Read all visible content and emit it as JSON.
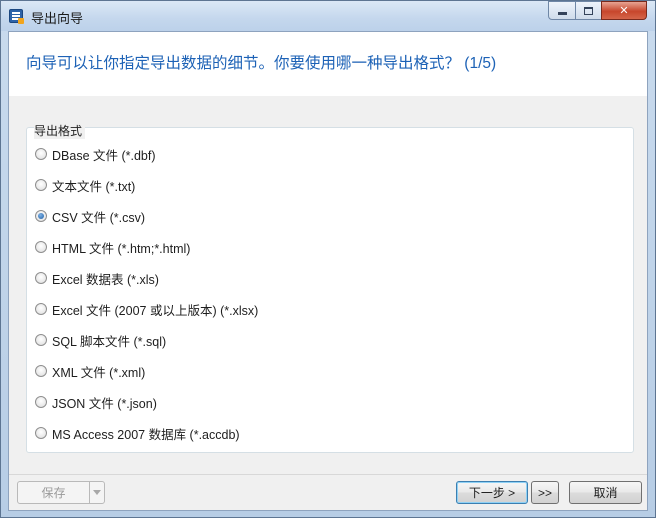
{
  "window": {
    "title": "导出向导",
    "controls": {
      "minimize": "minimize",
      "maximize": "maximize",
      "close": "✕"
    }
  },
  "header": {
    "text": "向导可以让你指定导出数据的细节。你要使用哪一种导出格式？ (1/5)"
  },
  "format_group": {
    "title": "导出格式",
    "options": [
      {
        "label": "DBase 文件 (*.dbf)",
        "checked": false
      },
      {
        "label": "文本文件 (*.txt)",
        "checked": false
      },
      {
        "label": "CSV 文件 (*.csv)",
        "checked": true
      },
      {
        "label": "HTML 文件 (*.htm;*.html)",
        "checked": false
      },
      {
        "label": "Excel 数据表 (*.xls)",
        "checked": false
      },
      {
        "label": "Excel 文件 (2007 或以上版本) (*.xlsx)",
        "checked": false
      },
      {
        "label": "SQL 脚本文件 (*.sql)",
        "checked": false
      },
      {
        "label": "XML 文件 (*.xml)",
        "checked": false
      },
      {
        "label": "JSON 文件 (*.json)",
        "checked": false
      },
      {
        "label": "MS Access 2007 数据库 (*.accdb)",
        "checked": false
      }
    ]
  },
  "footer": {
    "save_label": "保存",
    "save_enabled": false,
    "next_label": "下一步 >",
    "fast_forward_label": ">>",
    "cancel_label": "取消"
  },
  "colors": {
    "header_text": "#1d62b6",
    "radio_checked": "#1e5fa6"
  }
}
